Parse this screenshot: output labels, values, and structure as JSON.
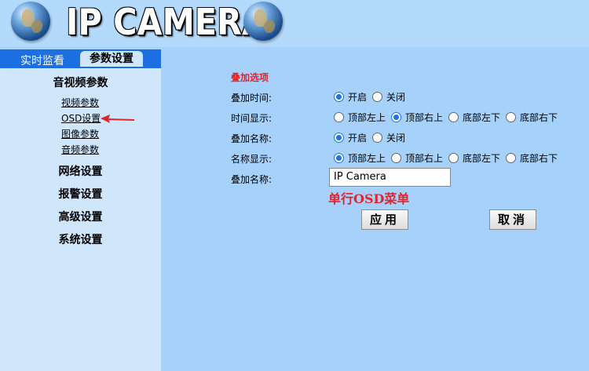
{
  "header": {
    "brand": "IP CAMERA"
  },
  "tabs": {
    "live": "实时监看",
    "params": "参数设置"
  },
  "sidebar": {
    "av_params": "音视频参数",
    "sub": [
      "视频参数",
      "OSD设置",
      "图像参数",
      "音频参数"
    ],
    "network": "网络设置",
    "alarm": "报警设置",
    "advanced": "高级设置",
    "system": "系统设置"
  },
  "form": {
    "section_title": "叠加选项",
    "rows": [
      {
        "label": "叠加时间:",
        "options": [
          "开启",
          "关闭"
        ],
        "selected": 0
      },
      {
        "label": "时间显示:",
        "options": [
          "顶部左上",
          "顶部右上",
          "底部左下",
          "底部右下"
        ],
        "selected": 1
      },
      {
        "label": "叠加名称:",
        "options": [
          "开启",
          "关闭"
        ],
        "selected": 0
      },
      {
        "label": "名称显示:",
        "options": [
          "顶部左上",
          "顶部右上",
          "底部左下",
          "底部右下"
        ],
        "selected": 0
      }
    ],
    "name_label": "叠加名称:",
    "name_value": "IP Camera",
    "hint": "单行OSD菜单",
    "apply": "应用",
    "cancel": "取消"
  },
  "colors": {
    "accent_blue": "#1c6fe0",
    "highlight_red": "#e3242b",
    "page_bg": "#a5d1fb"
  }
}
